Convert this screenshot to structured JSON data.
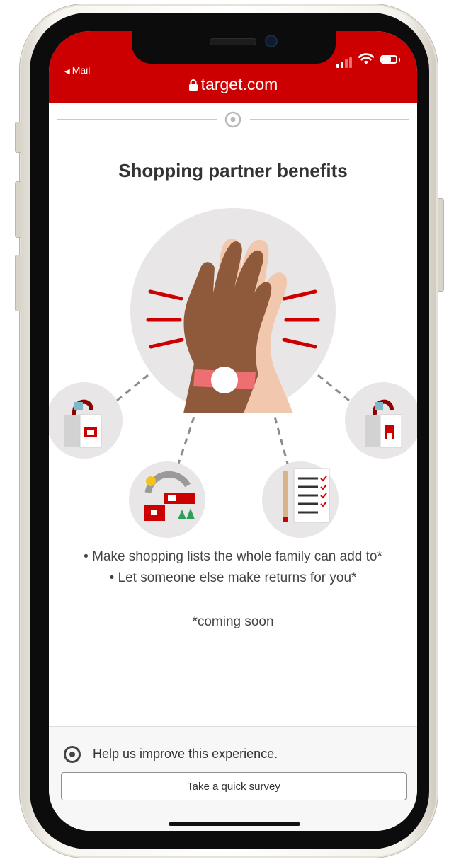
{
  "status_bar": {
    "back_label": "Mail",
    "icons": [
      "signal-icon",
      "wifi-icon",
      "battery-icon"
    ]
  },
  "browser": {
    "url": "target.com",
    "lock_icon": "lock-icon"
  },
  "content": {
    "title": "Shopping partner benefits",
    "bullets": [
      "• Make shopping lists the whole family can add to*",
      "• Let someone else make returns for you*"
    ],
    "footnote": "*coming soon",
    "illustration_icons": [
      "high-five-hands",
      "shopping-bag-store",
      "returns-box",
      "checklist",
      "shopping-bag-store"
    ]
  },
  "footer": {
    "help_text": "Help us improve this experience.",
    "survey_button_label": "Take a quick survey"
  },
  "colors": {
    "brand_red": "#cc0000",
    "text_dark": "#333333",
    "circle_gray": "#e8e6e6",
    "footer_bg": "#f7f7f7"
  }
}
